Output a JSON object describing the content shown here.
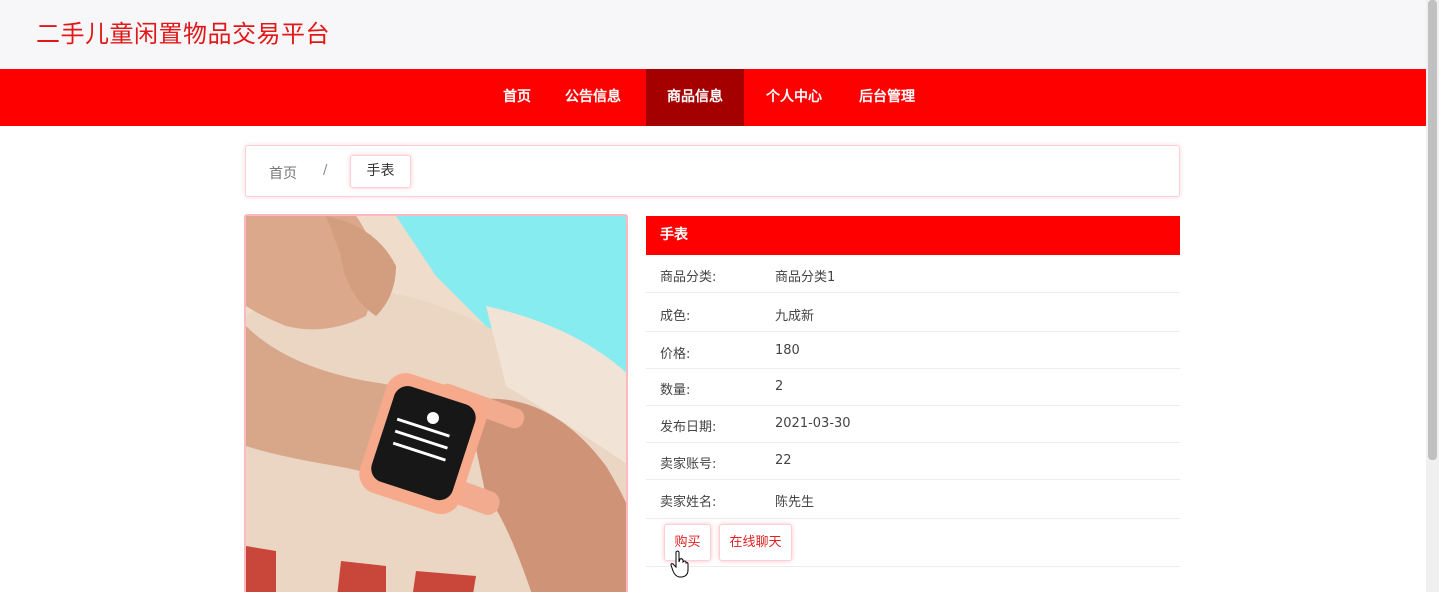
{
  "site": {
    "title": "二手儿童闲置物品交易平台"
  },
  "nav": {
    "items": [
      {
        "label": "首页"
      },
      {
        "label": "公告信息"
      },
      {
        "label": "商品信息"
      },
      {
        "label": "个人中心"
      },
      {
        "label": "后台管理"
      }
    ],
    "active": "商品信息"
  },
  "breadcrumb": {
    "home": "首页",
    "separator": "/",
    "current": "手表"
  },
  "product": {
    "title": "手表",
    "fields": [
      {
        "label": "商品分类:",
        "value": "商品分类1"
      },
      {
        "label": "成色:",
        "value": "九成新"
      },
      {
        "label": "价格:",
        "value": "180"
      },
      {
        "label": "数量:",
        "value": "2"
      },
      {
        "label": "发布日期:",
        "value": "2021-03-30"
      },
      {
        "label": "卖家账号:",
        "value": "22"
      },
      {
        "label": "卖家姓名:",
        "value": "陈先生"
      }
    ]
  },
  "actions": {
    "buy": "购买",
    "chat": "在线聊天"
  },
  "colors": {
    "primary": "#ff0000",
    "nav_active": "#a40000",
    "title": "#e21818",
    "border_pink": "#fbd1d6"
  }
}
